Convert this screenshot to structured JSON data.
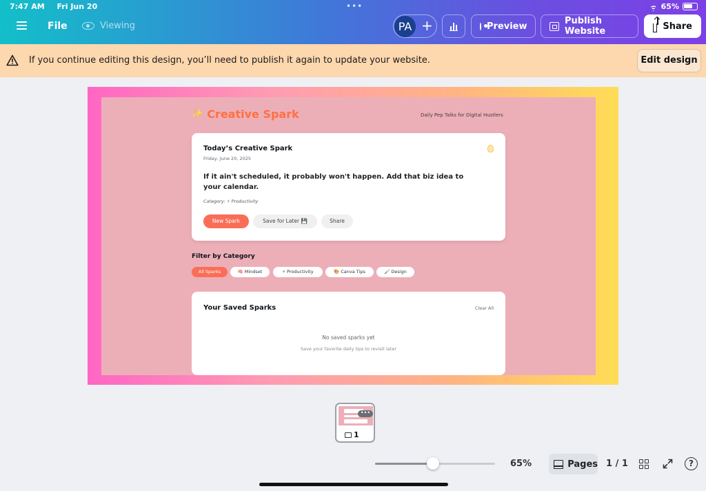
{
  "status_bar": {
    "time": "7:47 AM",
    "date": "Fri Jun 20",
    "battery": "65%"
  },
  "toolbar": {
    "file_label": "File",
    "viewing_label": "Viewing",
    "avatar_initials": "PA",
    "add_label": "+",
    "preview_label": "Preview",
    "publish_label": "Publish Website",
    "share_label": "Share",
    "accent_colors": [
      "#13bfc9",
      "#6a4fe0"
    ]
  },
  "banner": {
    "message": "If you continue editing this design, you’ll need to publish it again to update your website.",
    "edit_label": "Edit design",
    "background": "#fdd7ae"
  },
  "design": {
    "brand": "Creative Spark",
    "brand_icon": "✨",
    "tagline": "Daily Pep Talks for Digital Hustlers",
    "card": {
      "title": "Today’s Creative Spark",
      "date": "Friday, June 20, 2025",
      "quote": "If it ain't scheduled, it probably won't happen. Add that biz idea to your calendar.",
      "category": "Category: ⚡ Productivity",
      "new_label": "New Spark",
      "save_label": "Save for Later 💾",
      "share_label": "Share"
    },
    "filter": {
      "title": "Filter by Category",
      "chips": [
        "All Sparks",
        "🧠 Mindset",
        "⚡ Productivity",
        "🎨 Canva Tips",
        "🖌 Design"
      ]
    },
    "saved": {
      "title": "Your Saved Sparks",
      "clear_label": "Clear All",
      "empty_title": "No saved sparks yet",
      "empty_sub": "Save your favorite daily tips to revisit later"
    }
  },
  "thumbnail": {
    "page_number": "1",
    "more_label": "•••"
  },
  "bottom_bar": {
    "zoom": "65%",
    "zoom_fraction": 0.48,
    "pages_label": "Pages",
    "page_count": "1 / 1",
    "help_label": "?"
  }
}
